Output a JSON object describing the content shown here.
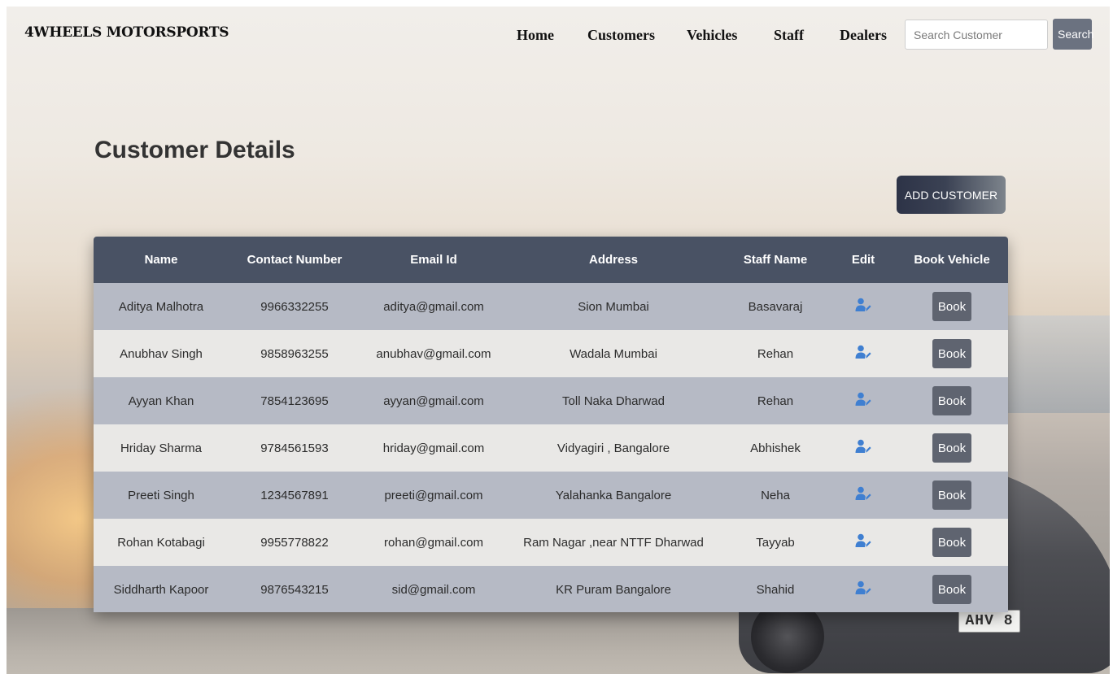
{
  "brand": "4WHEELS MOTORSPORTS",
  "nav": {
    "items": [
      {
        "label": "Home"
      },
      {
        "label": "Customers"
      },
      {
        "label": "Vehicles"
      },
      {
        "label": "Staff"
      },
      {
        "label": "Dealers"
      }
    ],
    "search_placeholder": "Search Customer",
    "search_label": "Search"
  },
  "page": {
    "title": "Customer Details",
    "add_label": "ADD CUSTOMER"
  },
  "background": {
    "plate_text": "AHV 8"
  },
  "table": {
    "headers": [
      "Name",
      "Contact Number",
      "Email Id",
      "Address",
      "Staff Name",
      "Edit",
      "Book Vehicle"
    ],
    "edit_icon": "user-edit-icon",
    "book_label": "Book",
    "rows": [
      {
        "name": "Aditya Malhotra",
        "contact": "9966332255",
        "email": "aditya@gmail.com",
        "address": "Sion Mumbai",
        "staff": "Basavaraj"
      },
      {
        "name": "Anubhav Singh",
        "contact": "9858963255",
        "email": "anubhav@gmail.com",
        "address": "Wadala Mumbai",
        "staff": "Rehan"
      },
      {
        "name": "Ayyan Khan",
        "contact": "7854123695",
        "email": "ayyan@gmail.com",
        "address": "Toll Naka Dharwad",
        "staff": "Rehan"
      },
      {
        "name": "Hriday Sharma",
        "contact": "9784561593",
        "email": "hriday@gmail.com",
        "address": "Vidyagiri , Bangalore",
        "staff": "Abhishek"
      },
      {
        "name": "Preeti Singh",
        "contact": "1234567891",
        "email": "preeti@gmail.com",
        "address": "Yalahanka Bangalore",
        "staff": "Neha"
      },
      {
        "name": "Rohan Kotabagi",
        "contact": "9955778822",
        "email": "rohan@gmail.com",
        "address": "Ram Nagar ,near NTTF Dharwad",
        "staff": "Tayyab"
      },
      {
        "name": "Siddharth Kapoor",
        "contact": "9876543215",
        "email": "sid@gmail.com",
        "address": "KR Puram Bangalore",
        "staff": "Shahid"
      }
    ]
  },
  "colors": {
    "header_bg": "#495264",
    "row_odd": "#b6bac5",
    "row_even": "#e9e8e6",
    "icon_blue": "#3f7fd1",
    "button_gray": "#5f6470"
  }
}
